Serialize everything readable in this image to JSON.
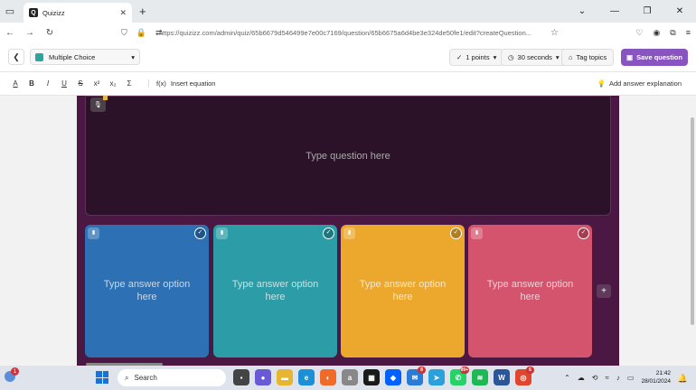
{
  "browser": {
    "tab_title": "Quizizz",
    "tab_favicon": "Q",
    "new_tab_label": "+",
    "url": "https://quizizz.com/admin/quiz/65b6679d546499e7e00c7169/question/65b6675a6d4be3e324de50fe1/edit?createQuestion...",
    "icons": [
      "back-icon",
      "forward-icon",
      "refresh-icon",
      "shield-icon",
      "lock-icon",
      "site-settings-icon",
      "star-icon",
      "pocket-icon",
      "profile-icon",
      "extensions-icon",
      "menu-icon"
    ]
  },
  "editor": {
    "question_type": "Multiple Choice",
    "points": "1 points",
    "time": "30 seconds",
    "tag_topics": "Tag topics",
    "save_question": "Save question"
  },
  "format": {
    "buttons": [
      "A",
      "B",
      "I",
      "U",
      "S",
      "x²",
      "x₂",
      "Σ"
    ],
    "insert_equation": "Insert equation",
    "insert_equation_icon": "f(x)",
    "add_answer_explanation": "Add answer explanation"
  },
  "question": {
    "placeholder": "Type question here"
  },
  "answers": [
    {
      "placeholder": "Type answer option here",
      "color": "#2d70b3"
    },
    {
      "placeholder": "Type answer option here",
      "color": "#2c9ca6"
    },
    {
      "placeholder": "Type answer option here",
      "color": "#eca82c"
    },
    {
      "placeholder": "Type answer option here",
      "color": "#d5546d"
    }
  ],
  "taskbar": {
    "notification_badge": "1",
    "search_placeholder": "Search",
    "app_badges": [
      "8",
      "99+",
      "6"
    ],
    "time": "21:42",
    "date": "28/01/2024"
  }
}
